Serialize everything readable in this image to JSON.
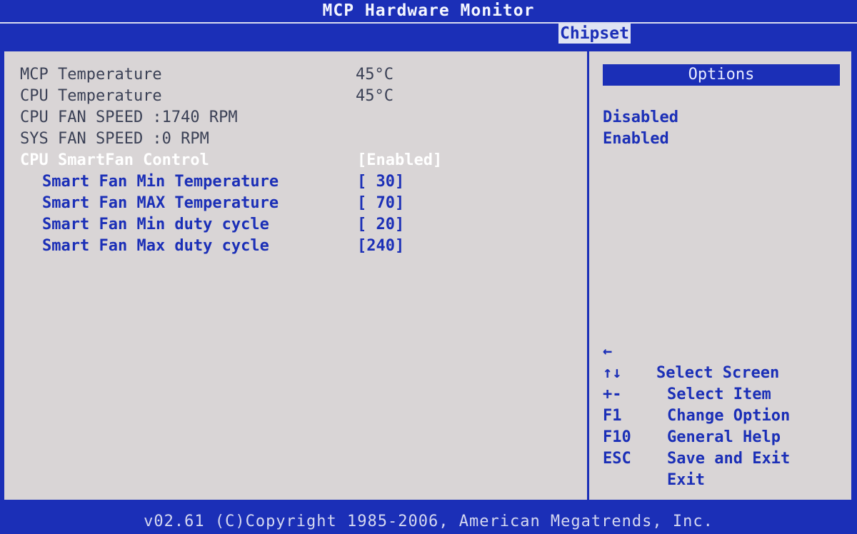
{
  "window": {
    "title": "MCP Hardware Monitor",
    "active_tab": "Chipset"
  },
  "monitor": {
    "mcp_temp_label": "MCP Temperature",
    "mcp_temp_value": "45°C",
    "cpu_temp_label": "CPU Temperature",
    "cpu_temp_value": "45°C",
    "cpu_fan_speed": "CPU FAN SPEED :1740 RPM",
    "sys_fan_speed": "SYS FAN SPEED :0 RPM"
  },
  "smartfan": {
    "control_label": "CPU SmartFan Control",
    "control_value": "[Enabled]",
    "settings": [
      {
        "label": "Smart Fan Min Temperature",
        "value": "[ 30]"
      },
      {
        "label": "Smart Fan MAX Temperature",
        "value": "[ 70]"
      },
      {
        "label": "Smart Fan Min duty cycle",
        "value": "[ 20]"
      },
      {
        "label": "Smart Fan Max duty cycle",
        "value": "[240]"
      }
    ]
  },
  "options_panel": {
    "header": "Options",
    "items": [
      "Disabled",
      "Enabled"
    ]
  },
  "help": [
    {
      "key": "←",
      "desc": "Select Screen"
    },
    {
      "key": "↑↓",
      "desc": "Select Item"
    },
    {
      "key": "+-",
      "desc": "Change Option"
    },
    {
      "key": "F1",
      "desc": "General Help"
    },
    {
      "key": "F10",
      "desc": "Save and Exit"
    },
    {
      "key": "ESC",
      "desc": "Exit"
    }
  ],
  "footer": {
    "copyright": "v02.61 (C)Copyright 1985-2006, American Megatrends, Inc."
  },
  "colors": {
    "bios_blue": "#1b2fb7",
    "panel_gray": "#d9d5d6",
    "highlight_white": "#ffffff"
  }
}
